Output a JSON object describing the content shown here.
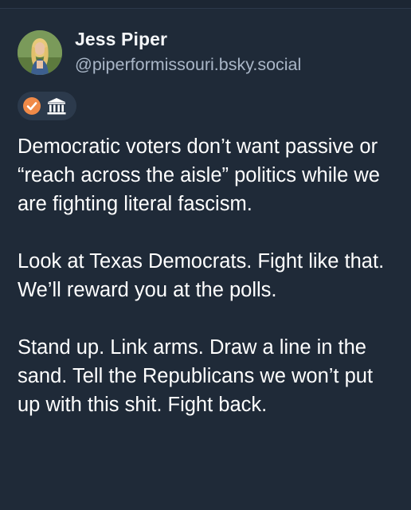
{
  "post": {
    "author": {
      "display_name": "Jess Piper",
      "handle": "@piperformissouri.bsky.social"
    },
    "badges": [
      {
        "icon": "verified-check-icon",
        "color": "#f08a48"
      },
      {
        "icon": "government-building-icon",
        "color": "#ffffff"
      }
    ],
    "paragraphs": [
      "Democratic voters don’t want passive or “reach across the aisle” politics while we are fighting literal fascism.",
      "Look at Texas Democrats. Fight like that. We’ll reward you at the polls.",
      "Stand up. Link arms. Draw a line in the sand. Tell the Republicans we won’t put up with this shit. Fight back."
    ]
  },
  "colors": {
    "background": "#1f2a38",
    "text": "#ffffff",
    "handle": "#a9b6c7",
    "badge_pill": "#2c3a4c",
    "check_badge": "#f08a48"
  }
}
